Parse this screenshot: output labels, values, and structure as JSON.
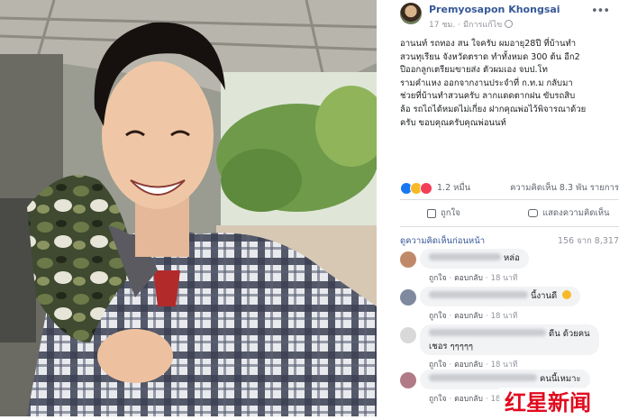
{
  "post": {
    "author": "Premyosapon Khongsai",
    "time": "17 ชม.",
    "privacy": "มีการแก้ไข",
    "text_lines": [
      "อานนท์ รถทอง สน ใจครับ ผมอายุ28ปี ที่บ้านทำ",
      "สวนทุเรียน จังหวัดตราด ทำทั้งหมด 300 ต้น อีก2",
      "ปีออกลูกเตรียมขายส่ง ตัวผมเอง จบป.โท",
      "รามคำแหง ออกจากงานประจำที่ ก.ท.ม กลับมา",
      "ช่วยที่บ้านทำสวนครับ ลากแดดตากฝน ขับรถสิบ",
      "ล้อ รถไถได้หมดไม่เกี่ยง ฝากคุณพ่อไว้พิจารณาด้วย",
      "ครับ ขอบคุณครับคุณพ่อนนท์"
    ]
  },
  "stats": {
    "reactions": "1.2 หมื่น",
    "comments_shares": "ความคิดเห็น 8.3 พัน รายการ"
  },
  "actions": {
    "like": "ถูกใจ",
    "comment": "แสดงความคิดเห็น"
  },
  "comments_header": {
    "sort": "ดูความคิดเห็นก่อนหน้า",
    "count": "156 จาก 8,317"
  },
  "comments": [
    {
      "text": "หล่อ",
      "like": "ถูกใจ",
      "reply": "ตอบกลับ",
      "time": "18 นาที"
    },
    {
      "text": "นี้งานดี",
      "like": "ถูกใจ",
      "reply": "ตอบกลับ",
      "time": "18 นาที"
    },
    {
      "text_1": "ดีน ด้วยคน",
      "text_2": "เชอร ๆๆๆๆๆ",
      "like": "ถูกใจ",
      "reply": "ตอบกลับ",
      "time": "18 นาที"
    },
    {
      "text": "คนนี้เหมาะ",
      "like": "ถูกใจ",
      "reply": "ตอบกลับ",
      "time": "18 นาที"
    }
  ],
  "watermark": {
    "text": "红星新闻"
  },
  "colors": {
    "link": "#365899",
    "muted": "#90949c",
    "like_blue": "#1877f2"
  }
}
